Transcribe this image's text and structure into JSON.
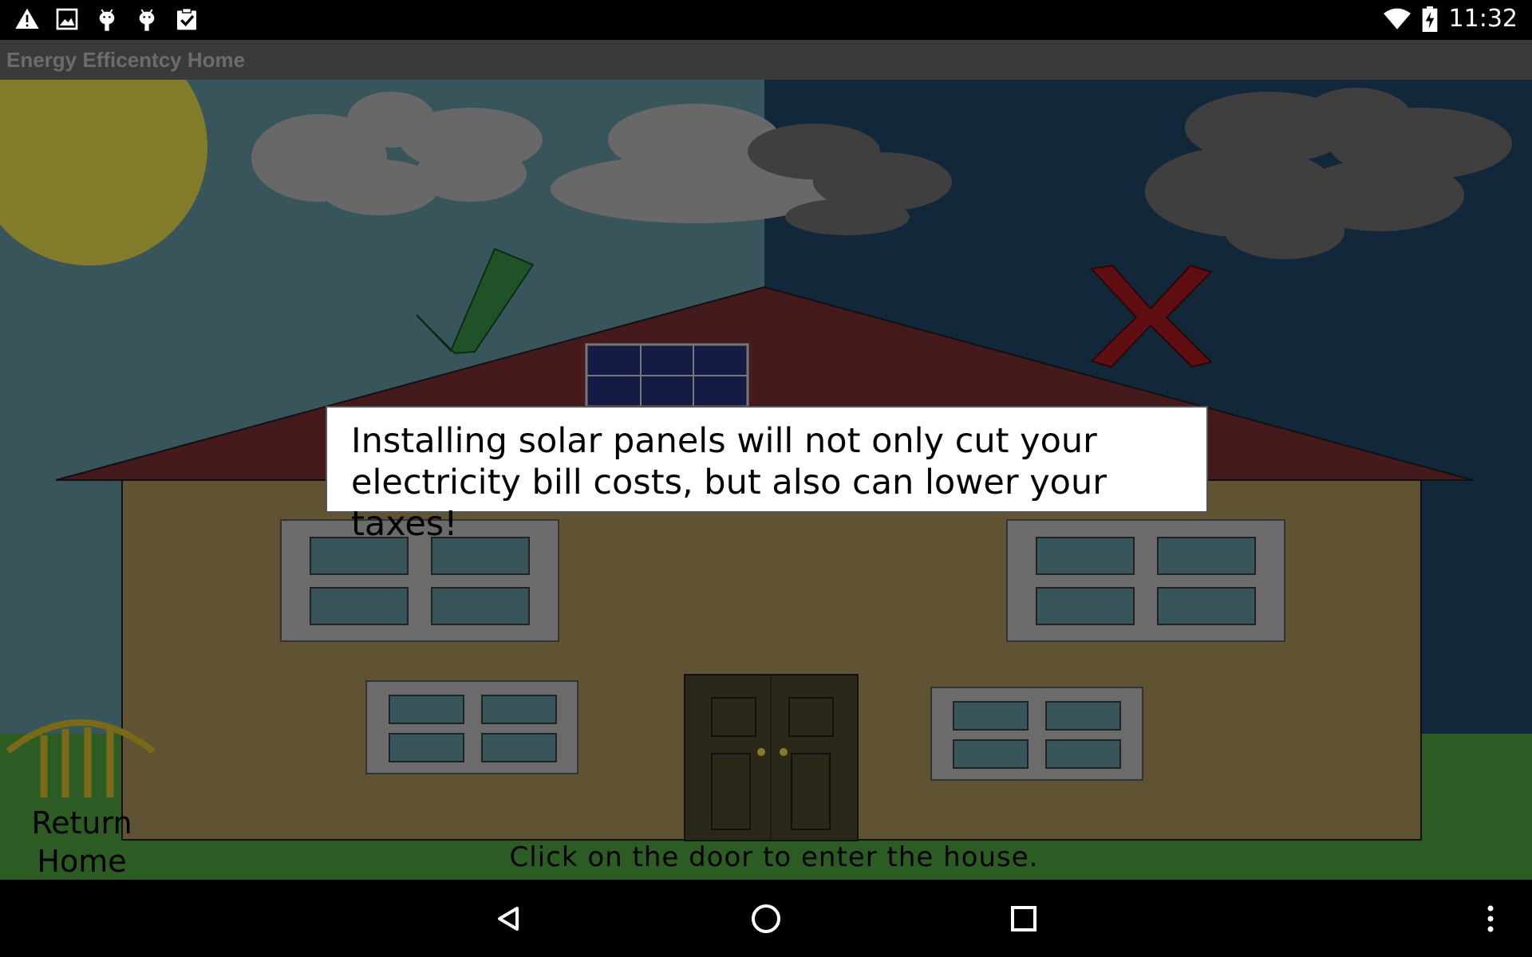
{
  "status_bar": {
    "time": "11:32",
    "left_icons": [
      "warning-icon",
      "image-icon",
      "android-icon",
      "android-icon",
      "clipboard-check-icon"
    ],
    "right_icons": [
      "wifi-icon",
      "battery-charging-icon"
    ]
  },
  "app_bar": {
    "title": "Energy Efficentcy Home"
  },
  "scene": {
    "info_text": "Installing solar panels will not only cut your electricity bill costs, but also  can lower your taxes!",
    "return_label": "Return Home",
    "hint_text": "Click on the door to enter the house.",
    "good_marker": "checkmark-icon",
    "bad_marker": "x-mark-icon",
    "colors": {
      "sky_day": "#38555b",
      "sky_night": "#12283a",
      "grass": "#2c5c24",
      "house_wall": "#5f5333",
      "roof": "#441a1d",
      "sun": "#827b2a",
      "check": "#1f5226",
      "cross": "#5f0f12"
    }
  },
  "nav_bar": {
    "buttons": [
      "back-icon",
      "home-icon",
      "recents-icon",
      "overflow-menu-icon"
    ]
  }
}
